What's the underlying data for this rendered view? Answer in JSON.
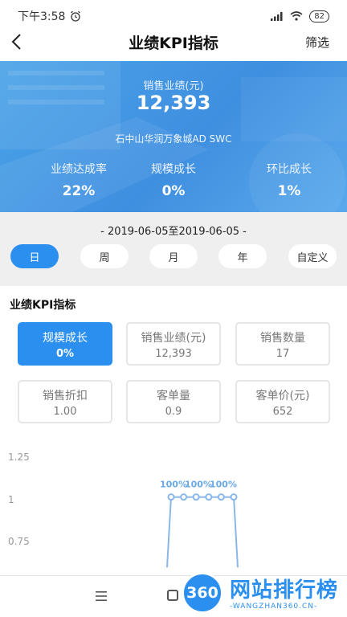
{
  "status": {
    "time": "下午3:58",
    "alarm_icon": "alarm-clock-icon",
    "signal_icon": "signal-icon",
    "wifi_icon": "wifi-icon",
    "battery": "82"
  },
  "nav": {
    "title": "业绩KPI指标",
    "back_icon": "chevron-left-icon",
    "filter_label": "筛选"
  },
  "hero": {
    "label": "销售业绩(元)",
    "value": "12,393",
    "store": "石中山华润万象城AD SWC",
    "stats": [
      {
        "label": "业绩达成率",
        "value": "22%"
      },
      {
        "label": "规模成长",
        "value": "0%"
      },
      {
        "label": "环比成长",
        "value": "1%"
      }
    ],
    "gradient_colors": [
      "#4aa3e8",
      "#3f8fe0",
      "#5aa9ec"
    ]
  },
  "date_range": "- 2019-06-05至2019-06-05 -",
  "periods": [
    {
      "label": "日",
      "active": true
    },
    {
      "label": "周",
      "active": false
    },
    {
      "label": "月",
      "active": false
    },
    {
      "label": "年",
      "active": false
    },
    {
      "label": "自定义",
      "active": false
    }
  ],
  "kpi_section": {
    "title": "业绩KPI指标",
    "cards": [
      {
        "label": "规模成长",
        "value": "0%",
        "active": true
      },
      {
        "label": "销售业绩(元)",
        "value": "12,393",
        "active": false
      },
      {
        "label": "销售数量",
        "value": "17",
        "active": false
      },
      {
        "label": "销售折扣",
        "value": "1.00",
        "active": false
      },
      {
        "label": "客单量",
        "value": "0.9",
        "active": false
      },
      {
        "label": "客单价(元)",
        "value": "652",
        "active": false
      }
    ]
  },
  "chart_data": {
    "type": "line",
    "y_ticks": [
      "1.25",
      "1",
      "0.75"
    ],
    "ylim": [
      0.5,
      1.25
    ],
    "values": [
      0.55,
      1,
      1,
      1,
      1,
      1,
      1,
      0.55
    ],
    "point_labels": [
      "100%",
      "100%",
      "100%"
    ],
    "line_color": "#8ab8ea"
  },
  "bottom_bar": {
    "menu_icon": "menu-icon",
    "home_icon": "home-square-icon"
  },
  "watermark": {
    "badge": "360",
    "title": "网站排行榜",
    "subtitle": "-WANGZHAN360.CN-"
  },
  "colors": {
    "accent": "#2b8ff0",
    "date_bar_bg": "#efefef"
  }
}
